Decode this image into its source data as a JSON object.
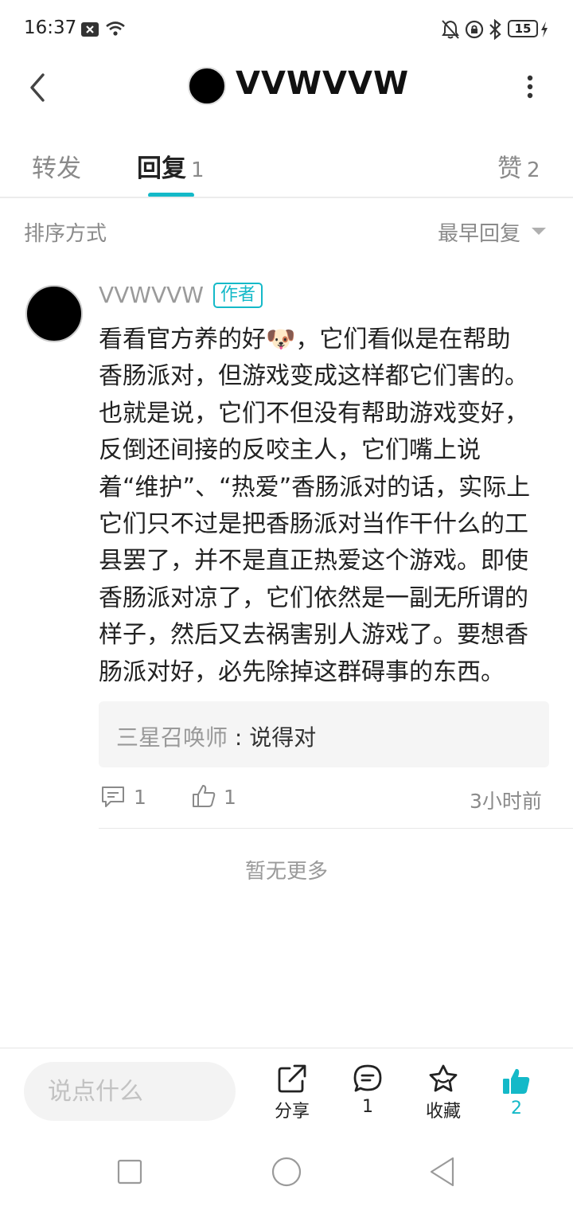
{
  "status_bar": {
    "time": "16:37",
    "battery": "15",
    "icons": [
      "notification-x-icon",
      "wifi-icon",
      "mute-bell-icon",
      "lock-rotation-icon",
      "bluetooth-icon",
      "battery-icon",
      "charging-icon"
    ]
  },
  "header": {
    "title": "VVWVVW",
    "back_icon": "chevron-left-icon",
    "more_icon": "more-vertical-icon"
  },
  "tabs": [
    {
      "label": "转发",
      "count": "",
      "active": false
    },
    {
      "label": "回复",
      "count": "1",
      "active": true
    },
    {
      "label": "赞",
      "count": "2",
      "active": false
    }
  ],
  "accent_color": "#14b9c8",
  "sort": {
    "label": "排序方式",
    "value": "最早回复"
  },
  "comment": {
    "author": "VVWVVW",
    "badge": "作者",
    "emoji": "🐶",
    "text_before_emoji": "看看官方养的好",
    "text_after_emoji": "，它们看似是在帮助\n香肠派对，但游戏变成这样都它们害的。\n也就是说，它们不但没有帮助游戏变好，\n反倒还间接的反咬主人，它们嘴上说\n着“维护”、“热爱”香肠派对的话，实际上\n它们只不过是把香肠派对当作干什么的工\n县罢了，并不是直正热爱这个游戏。即使\n香肠派对凉了，它们依然是一副无所谓的\n样子，然后又去祸害别人游戏了。要想香\n肠派对好，必先除掉这群碍事的东西。",
    "quote": {
      "name": "三星召唤师",
      "separator": " : ",
      "text": "说得对"
    },
    "reply_count": "1",
    "like_count": "1",
    "time_ago": "3小时前"
  },
  "no_more": "暂无更多",
  "bottom_bar": {
    "input_placeholder": "说点什么",
    "share_label": "分享",
    "comment_count": "1",
    "favorite_label": "收藏",
    "like_count": "2"
  },
  "nav_bar": {
    "icons": [
      "recents-square-icon",
      "home-circle-icon",
      "back-triangle-icon"
    ]
  }
}
